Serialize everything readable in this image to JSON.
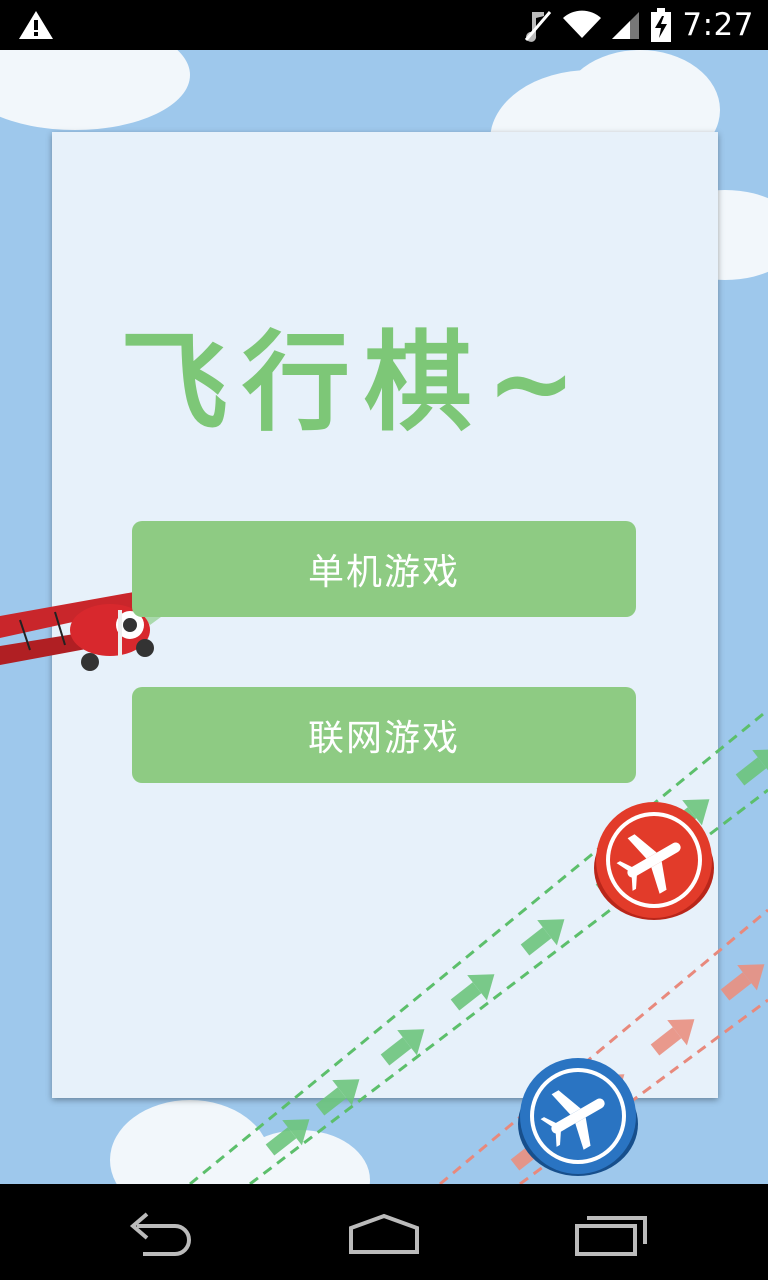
{
  "status_bar": {
    "time": "7:27",
    "icons": [
      "warning-icon",
      "mute-icon",
      "wifi-icon",
      "signal-icon",
      "battery-charging-icon"
    ]
  },
  "app": {
    "title": "飞行棋~",
    "title_color": "#7dc777",
    "button_color": "#8ecb83",
    "single_player_label": "单机游戏",
    "online_label": "联网游戏"
  },
  "nav_bar": {
    "icons": [
      "back-icon",
      "home-icon",
      "recents-icon"
    ]
  }
}
